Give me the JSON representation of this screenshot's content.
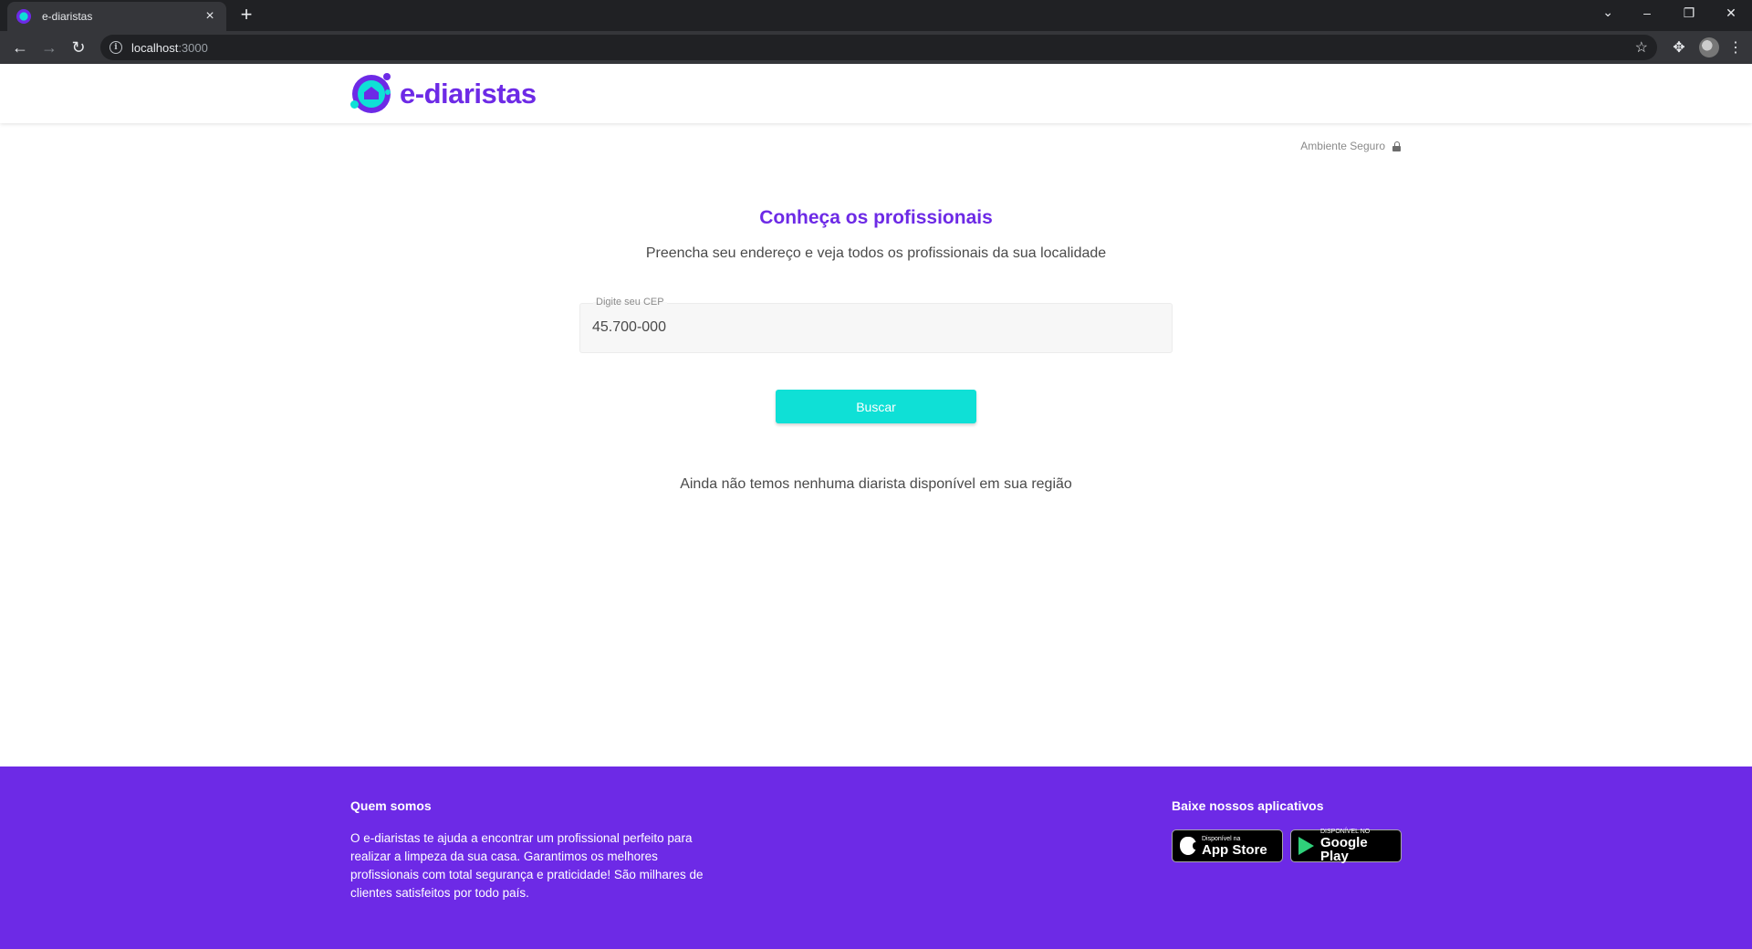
{
  "browser": {
    "tab_title": "e-diaristas",
    "tab_close": "×",
    "new_tab": "+",
    "url_host": "localhost",
    "url_port": ":3000",
    "window_controls": {
      "tab_search": "⌄",
      "minimize": "–",
      "restore": "❐",
      "close": "✕"
    }
  },
  "header": {
    "logo_text": "e-diaristas"
  },
  "secure": {
    "label": "Ambiente Seguro"
  },
  "main": {
    "title": "Conheça os profissionais",
    "subtitle": "Preencha seu endereço e veja todos os profissionais da sua localidade",
    "cep_label": "Digite seu CEP",
    "cep_value": "45.700-000",
    "search_button": "Buscar",
    "empty_message": "Ainda não temos nenhuma diarista disponível em sua região"
  },
  "footer": {
    "about_title": "Quem somos",
    "about_text": "O e-diaristas te ajuda a encontrar um profissional perfeito para realizar a limpeza da sua casa. Garantimos os melhores profissionais com total segurança e praticidade! São milhares de clientes satisfeitos por todo país.",
    "apps_title": "Baixe nossos aplicativos",
    "app_store": {
      "small": "Disponível na",
      "big": "App Store"
    },
    "google_play": {
      "small": "DISPONÍVEL NO",
      "big": "Google Play"
    }
  },
  "colors": {
    "brand_purple": "#6d2ae6",
    "accent_cyan": "#0fe0d6"
  }
}
